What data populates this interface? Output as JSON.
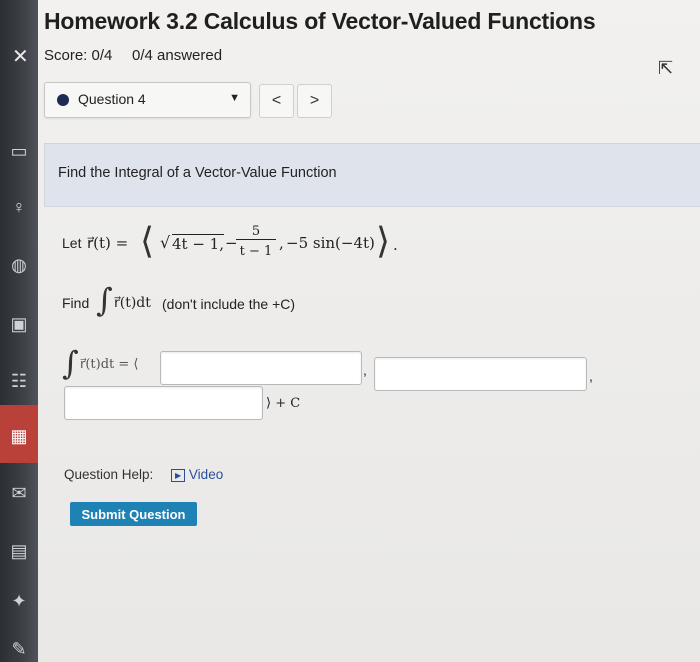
{
  "header": {
    "title": "Homework 3.2 Calculus of Vector-Valued Functions",
    "score": "Score: 0/4",
    "answered": "0/4 answered"
  },
  "question_nav": {
    "selected": "Question 4",
    "prev": "<",
    "next": ">"
  },
  "card": {
    "heading": "Find the Integral of a Vector-Value Function"
  },
  "problem": {
    "let_prefix": "Let",
    "fn_lhs": "r⃗(t) =",
    "sqrt_radicand": "4t − 1,",
    "frac_num": "5",
    "frac_den": "t − 1",
    "third": "−5 sin(−4t)",
    "find_prefix": "Find",
    "integrand": "r⃗(t)dt",
    "instruction": "(don't include the +C)",
    "answer_lhs": "r⃗(t)dt = ⟨",
    "plus_c": "⟩ + C"
  },
  "answers": {
    "field1": "",
    "field2": "",
    "field3": ""
  },
  "help": {
    "label": "Question Help:",
    "video": "Video"
  },
  "submit_label": "Submit Question",
  "icons": [
    "close-icon",
    "chevron-down-icon",
    "chevron-left-icon",
    "chevron-right-icon",
    "video-icon",
    "cursor-icon",
    "user-icon",
    "globe-icon",
    "gradebook-icon",
    "people-icon",
    "calendar-icon",
    "mail-icon",
    "notes-icon",
    "tools-icon",
    "edit-icon"
  ]
}
